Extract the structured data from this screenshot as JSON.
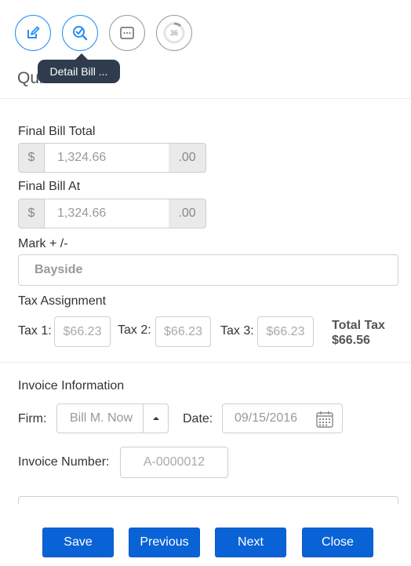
{
  "toolbar": {
    "progress_number": "36",
    "tooltip": "Detail Bill ...",
    "colors": {
      "active": "#2a8ef0",
      "inactive": "#9b9b9b",
      "tooltip_bg": "#2e3c4d"
    }
  },
  "page": {
    "title": "Quick Bill"
  },
  "final_bill_total": {
    "label": "Final Bill Total",
    "currency": "$",
    "value": "1,324.66",
    "cents": ".00"
  },
  "final_bill_at": {
    "label": "Final Bill At",
    "currency": "$",
    "value": "1,324.66",
    "cents": ".00"
  },
  "mark": {
    "label": "Mark + /-",
    "value": "Bayside"
  },
  "tax": {
    "heading": "Tax Assignment",
    "items": [
      {
        "label": "Tax 1:",
        "placeholder": "$66.23"
      },
      {
        "label": "Tax 2:",
        "placeholder": "$66.23"
      },
      {
        "label": "Tax 3:",
        "placeholder": "$66.23"
      }
    ],
    "total_label": "Total Tax",
    "total_value": "$66.56"
  },
  "invoice": {
    "heading": "Invoice Information",
    "firm_label": "Firm:",
    "firm_value": "Bill M. Now",
    "date_label": "Date:",
    "date_value": "09/15/2016",
    "number_label": "Invoice Number:",
    "number_value": "A-0000012"
  },
  "footer": {
    "save": "Save",
    "previous": "Previous",
    "next": "Next",
    "close": "Close",
    "button_color": "#0a63d6"
  }
}
